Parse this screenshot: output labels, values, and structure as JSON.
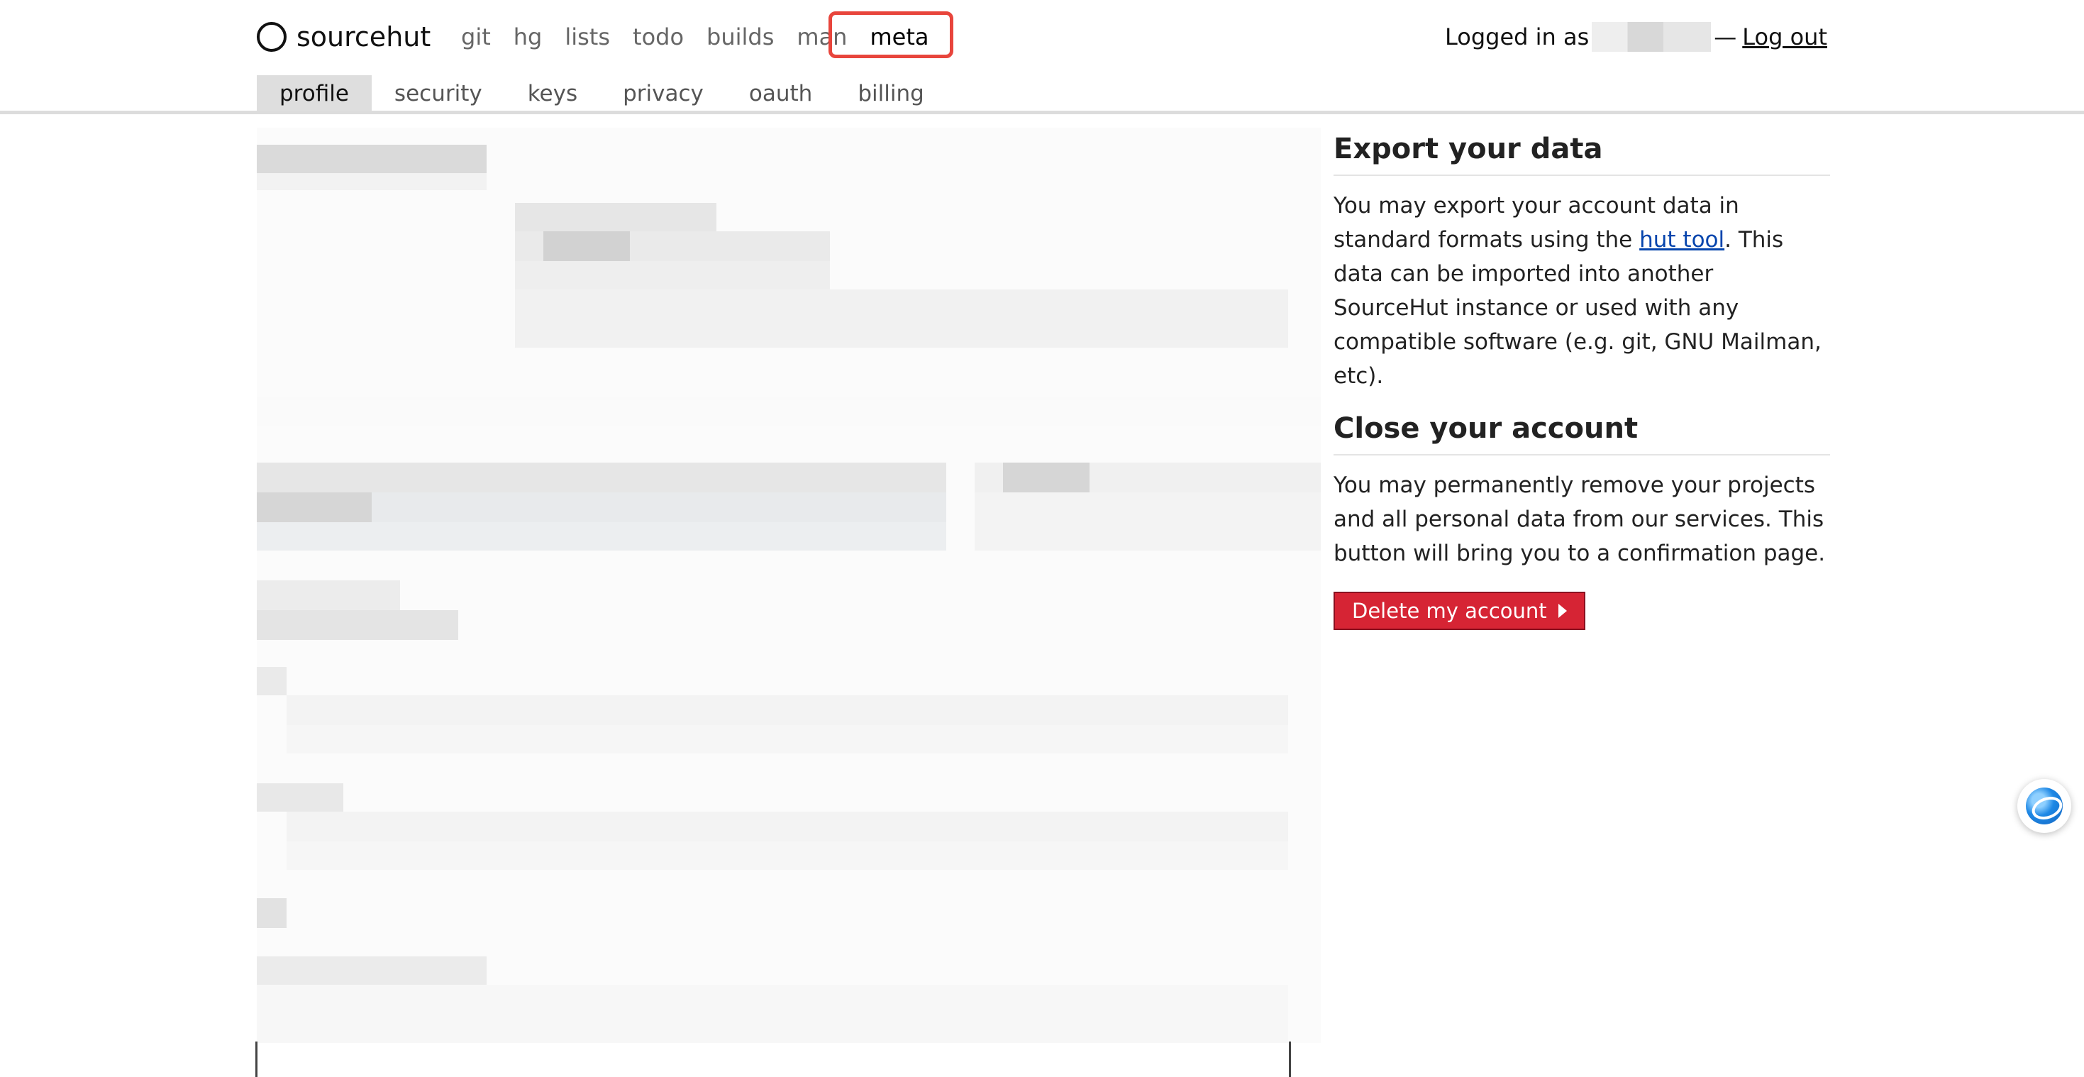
{
  "brand": {
    "name": "sourcehut"
  },
  "services": [
    {
      "label": "git",
      "active": false
    },
    {
      "label": "hg",
      "active": false
    },
    {
      "label": "lists",
      "active": false
    },
    {
      "label": "todo",
      "active": false
    },
    {
      "label": "builds",
      "active": false
    },
    {
      "label": "man",
      "active": false
    },
    {
      "label": "meta",
      "active": true
    }
  ],
  "login": {
    "prefix": "Logged in as",
    "separator": "—",
    "logout_label": "Log out"
  },
  "subnav": [
    {
      "label": "profile",
      "active": true
    },
    {
      "label": "security",
      "active": false
    },
    {
      "label": "keys",
      "active": false
    },
    {
      "label": "privacy",
      "active": false
    },
    {
      "label": "oauth",
      "active": false
    },
    {
      "label": "billing",
      "active": false
    }
  ],
  "sidebar": {
    "export": {
      "title": "Export your data",
      "text_before": "You may export your account data in standard formats using the ",
      "link_label": "hut tool",
      "text_after": ". This data can be imported into another SourceHut instance or used with any compatible software (e.g. git, GNU Mailman, etc)."
    },
    "close": {
      "title": "Close your account",
      "text": "You may permanently remove your projects and all personal data from our services. This button will bring you to a confirmation page.",
      "button_label": "Delete my account"
    }
  },
  "colors": {
    "danger": "#d62434",
    "highlight": "#e8453c",
    "link": "#0645ad",
    "active_tab": "#dedede"
  },
  "icons": {
    "brand": "circle-logo-icon",
    "button": "caret-right-icon",
    "widget": "assistant-orb-icon"
  }
}
